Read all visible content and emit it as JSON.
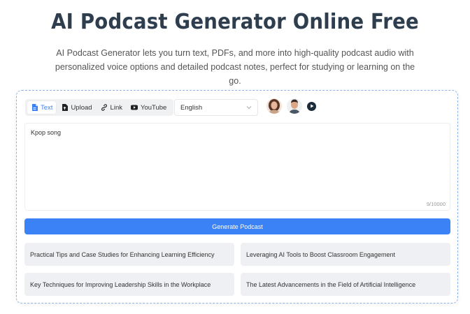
{
  "hero": {
    "title": "AI Podcast Generator Online Free",
    "subtitle": "AI Podcast Generator lets you turn text, PDFs, and more into high-quality podcast audio with personalized voice options and detailed podcast notes, perfect for studying or learning on the go."
  },
  "tabs": [
    {
      "label": "Text",
      "icon": "document-icon",
      "active": true
    },
    {
      "label": "Upload",
      "icon": "file-upload-icon"
    },
    {
      "label": "Link",
      "icon": "link-icon"
    },
    {
      "label": "YouTube",
      "icon": "youtube-icon"
    }
  ],
  "language": {
    "selected": "English"
  },
  "input": {
    "value": "Kpop song",
    "counter": "9/10000"
  },
  "generate": {
    "label": "Generate Podcast"
  },
  "suggestions": [
    "Practical Tips and Case Studies for Enhancing Learning Efficiency",
    "Leveraging AI Tools to Boost Classroom Engagement",
    "Key Techniques for Improving Leadership Skills in the Workplace",
    "The Latest Advancements in the Field of Artificial Intelligence"
  ],
  "colors": {
    "accent": "#3b82f6",
    "title": "#2e3e4e",
    "suggestion_bg": "#eef0f3"
  }
}
